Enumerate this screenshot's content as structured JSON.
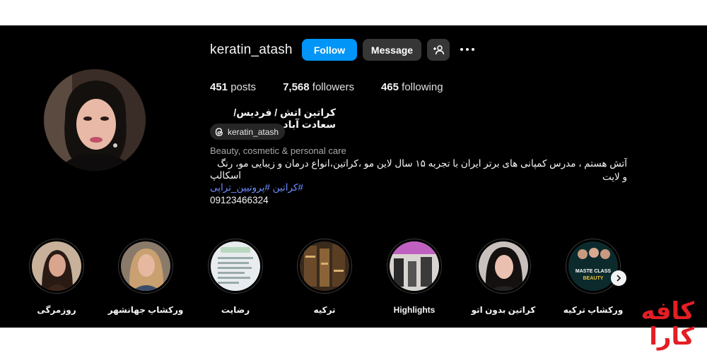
{
  "profile": {
    "username": "keratin_atash",
    "follow_label": "Follow",
    "message_label": "Message",
    "add_user_icon": "person-plus-icon",
    "more_icon": "more-dots-icon"
  },
  "stats": {
    "posts_count": "451",
    "posts_label": "posts",
    "followers_count": "7,568",
    "followers_label": "followers",
    "following_count": "465",
    "following_label": "following"
  },
  "bio": {
    "full_name": "کراتین اتش / فردیس/سعادت آباد",
    "threads_handle": "keratin_atash",
    "category": "Beauty, cosmetic & personal care",
    "line1": "آتش هستم ، مدرس کمپانی های برتر ایران با تجربه ۱۵ سال لاین مو ،کراتین،انواع درمان و زیبایی مو، رنگ و لایت",
    "line2": "اسکالپ",
    "hashtags": "#کراتین #پروتیین_تراپی",
    "phone": "09123466324"
  },
  "highlights": [
    {
      "label": "روزمرگی"
    },
    {
      "label": "ورکشاپ جهانشهر"
    },
    {
      "label": "رضایت"
    },
    {
      "label": "ترکیه"
    },
    {
      "label": "Highlights"
    },
    {
      "label": "کراتین بدون اتو"
    },
    {
      "label": "ورکشاپ ترکیه"
    }
  ],
  "highlight_thumb_texts": {
    "masterclass_line1": "MASTE CLASS",
    "masterclass_line2": "BEAUTY"
  },
  "watermark": {
    "line1": "کافه",
    "line2": "کارا"
  },
  "colors": {
    "background": "#000000",
    "follow_button": "#0095f6",
    "secondary_button": "#363636",
    "hashtag": "#6e8cff",
    "watermark": "#e31e24"
  }
}
